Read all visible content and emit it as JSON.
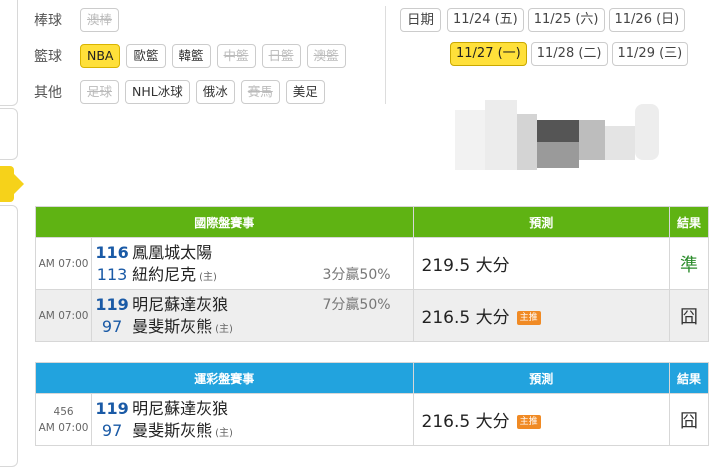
{
  "filters": {
    "baseball": {
      "label": "棒球",
      "tags": [
        {
          "text": "澳棒",
          "state": "disabled"
        }
      ]
    },
    "basketball": {
      "label": "籃球",
      "tags": [
        {
          "text": "NBA",
          "state": "active"
        },
        {
          "text": "歐籃",
          "state": "normal"
        },
        {
          "text": "韓籃",
          "state": "normal"
        },
        {
          "text": "中籃",
          "state": "disabled"
        },
        {
          "text": "日籃",
          "state": "disabled"
        },
        {
          "text": "澳籃",
          "state": "disabled"
        }
      ]
    },
    "other": {
      "label": "其他",
      "tags": [
        {
          "text": "足球",
          "state": "disabled"
        },
        {
          "text": "NHL冰球",
          "state": "normal"
        },
        {
          "text": "俄冰",
          "state": "normal"
        },
        {
          "text": "賽馬",
          "state": "disabled"
        },
        {
          "text": "美足",
          "state": "normal"
        }
      ]
    }
  },
  "dates": {
    "label": "日期",
    "row1": [
      "11/24 (五)",
      "11/25 (六)",
      "11/26 (日)"
    ],
    "row2": [
      "11/27 (一)",
      "11/28 (二)",
      "11/29 (三)"
    ],
    "active": "11/27 (一)"
  },
  "intl": {
    "headers": {
      "event": "國際盤賽事",
      "predict": "預測",
      "result": "結果"
    },
    "games": [
      {
        "time": "AM 07:00",
        "away_score": "116",
        "away_team": "鳳凰城太陽",
        "home_score": "113",
        "home_team": "紐約尼克",
        "home_mark": "(主)",
        "odds": "3分贏50%",
        "odds_line": "home",
        "prediction": "219.5 大分",
        "badge": "",
        "result": "準",
        "result_type": "ok"
      },
      {
        "time": "AM 07:00",
        "away_score": "119",
        "away_team": "明尼蘇達灰狼",
        "home_score": "97",
        "home_team": "曼斐斯灰熊",
        "home_mark": "(主)",
        "odds": "7分贏50%",
        "odds_line": "away",
        "prediction": "216.5 大分",
        "badge": "主推",
        "result": "囧",
        "result_type": "bad"
      }
    ]
  },
  "lottery": {
    "headers": {
      "event": "運彩盤賽事",
      "predict": "預測",
      "result": "結果"
    },
    "games": [
      {
        "code": "456",
        "time": "AM 07:00",
        "away_score": "119",
        "away_team": "明尼蘇達灰狼",
        "home_score": "97",
        "home_team": "曼斐斯灰熊",
        "home_mark": "(主)",
        "prediction": "216.5 大分",
        "badge": "主推",
        "result": "囧",
        "result_type": "bad"
      }
    ]
  },
  "colors": {
    "green_header": "#5fb313",
    "blue_header": "#22a3de",
    "active_tag": "#ffe03a",
    "score_blue": "#1a5aa6",
    "badge_orange": "#f08a24",
    "result_ok": "#2c8c2c"
  }
}
